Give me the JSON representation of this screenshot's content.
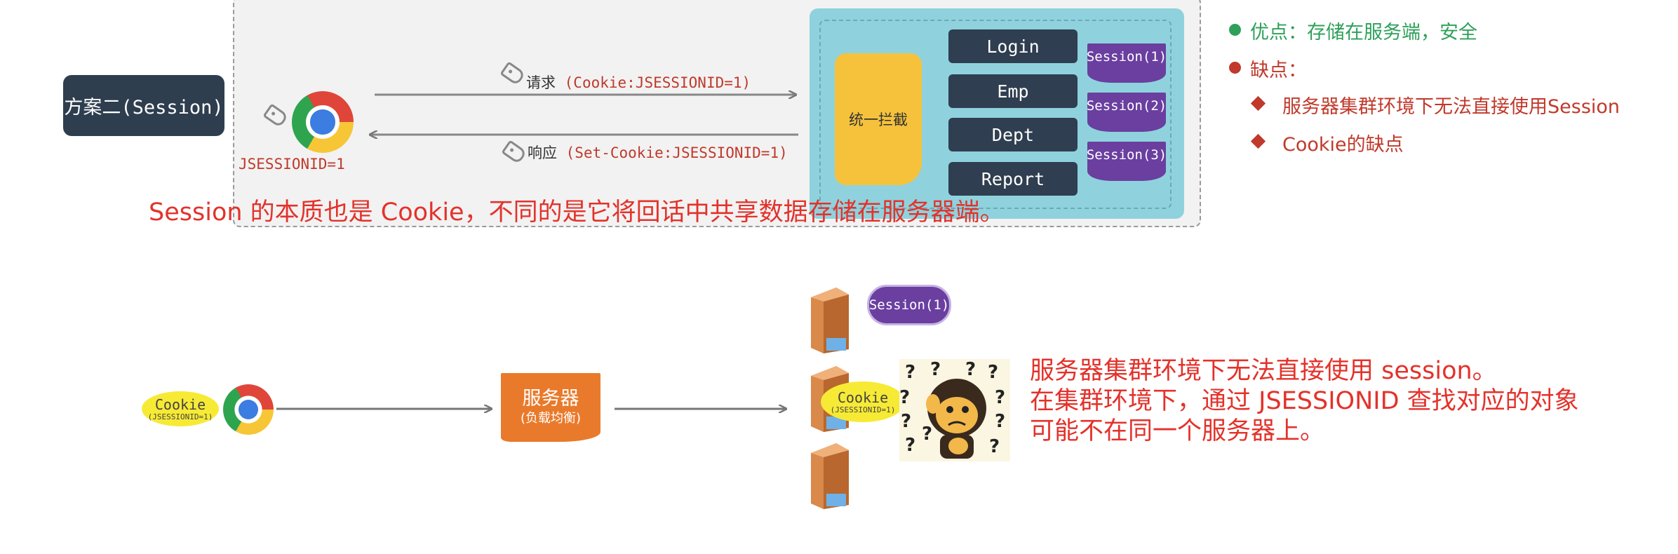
{
  "plan_label": "方案二(Session)",
  "client": {
    "cookie_name": "JSESSIONID=1"
  },
  "request": {
    "label_cn": "请求",
    "label_code": "(Cookie:JSESSIONID=1)"
  },
  "response": {
    "label_cn": "响应",
    "label_code": "(Set-Cookie:JSESSIONID=1)"
  },
  "interceptor_label": "统一拦截",
  "services": [
    "Login",
    "Emp",
    "Dept",
    "Report"
  ],
  "sessions": [
    "Session(1)",
    "Session(2)",
    "Session(3)"
  ],
  "caption": "Session 的本质也是 Cookie，不同的是它将回话中共享数据存储在服务器端。",
  "pros": "优点：存储在服务端，安全",
  "cons": {
    "title": "缺点：",
    "items": [
      "服务器集群环境下无法直接使用Session",
      "Cookie的缺点"
    ]
  },
  "cluster": {
    "cookie_bubble": {
      "title": "Cookie",
      "sub": "(JSESSIONID=1)"
    },
    "load_balancer": {
      "title": "服务器",
      "sub": "(负载均衡)"
    },
    "session_pill": "Session(1)",
    "question_marks": [
      "?",
      "?",
      "?",
      "?",
      "?",
      "?",
      "?",
      "?",
      "?",
      "?",
      "?"
    ],
    "note_lines": [
      "服务器集群环境下无法直接使用 session。",
      "在集群环境下，通过 JSESSIONID 查找对应的对象",
      "可能不在同一个服务器上。"
    ]
  },
  "colors": {
    "dark_navy": "#2e3e4f",
    "panel_teal": "#8fd2dd",
    "interceptor_yellow": "#f6c23c",
    "session_purple": "#6a3fa0",
    "caption_red": "#e3322b",
    "pros_green": "#2ea05a",
    "cons_red": "#c0392b",
    "lb_orange": "#e97a2b",
    "cookie_yellow": "#f7ea35"
  }
}
